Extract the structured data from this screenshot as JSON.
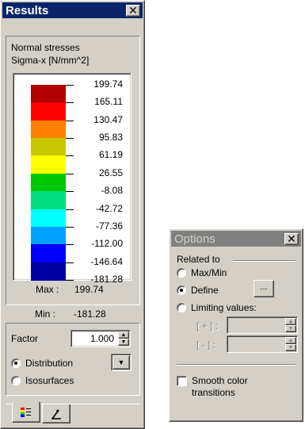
{
  "results": {
    "title": "Results",
    "label_line1": "Normal stresses",
    "label_line2": "Sigma-x [N/mm^2]",
    "legend_values": [
      "199.74",
      "165.11",
      "130.47",
      "95.83",
      "61.19",
      "26.55",
      "-8.08",
      "-42.72",
      "-77.36",
      "-112.00",
      "-146.64",
      "-181.28"
    ],
    "legend_colors": [
      "#b00000",
      "#ff0000",
      "#ff8000",
      "#c8c800",
      "#ffff00",
      "#00c800",
      "#00e080",
      "#00ffff",
      "#00a0ff",
      "#0000ff",
      "#0000a0"
    ],
    "max_label": "Max :",
    "max_value": "199.74",
    "min_label": "Min :",
    "min_value": "-181.28",
    "factor_label": "Factor",
    "factor_value": "1.000",
    "opt_distribution": "Distribution",
    "opt_isosurfaces": "Isosurfaces",
    "selected": "Distribution"
  },
  "options": {
    "title": "Options",
    "group_label": "Related to",
    "opt_maxmin": "Max/Min",
    "opt_define": "Define",
    "define_button": "...",
    "opt_limiting": "Limiting values:",
    "plus_label": "[ + ] :",
    "minus_label": "[ - ] :",
    "plus_value": "",
    "minus_value": "",
    "smooth_line1": "Smooth color",
    "smooth_line2": "transitions",
    "smooth_checked": false,
    "selected": "Define"
  },
  "colors": {
    "results_titlebar": "#0a246a",
    "options_titlebar": "#808080",
    "face": "#d4d0c8"
  }
}
